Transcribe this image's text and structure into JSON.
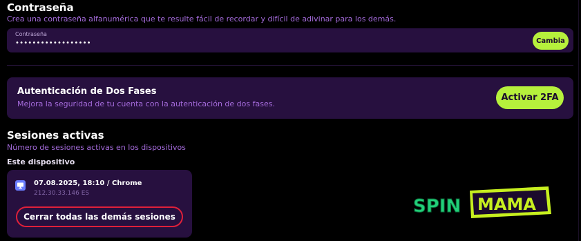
{
  "password_section": {
    "title": "Contraseña",
    "description": "Crea una contraseña alfanumérica que te resulte fácil de recordar y difícil de adivinar para los demás.",
    "field_label": "Contraseña",
    "field_value": "••••••••••••••••••",
    "change_button": "Cambia"
  },
  "two_factor": {
    "title": "Autenticación de Dos Fases",
    "description": "Mejora la seguridad de tu cuenta con la autenticación de dos fases.",
    "button": "Activar 2FA"
  },
  "sessions": {
    "title": "Sesiones activas",
    "description": "Número de sesiones activas en los dispositivos",
    "this_device_label": "Este dispositivo",
    "current": {
      "datetime_browser": "07.08.2025, 18:10 / Chrome",
      "ip_country": "212.30.33.146 ES"
    },
    "close_others_button": "Cerrar todas las demás sesiones"
  },
  "logo": {
    "part1": "SPIN",
    "part2": "MAMA"
  },
  "colors": {
    "background": "#000000",
    "card": "#27103f",
    "accent_green": "#b6f03c",
    "accent_purple": "#a56bdc",
    "danger_red": "#e0203a",
    "device_icon_blue": "#6a7dff"
  },
  "icons": {
    "device": "monitor-icon"
  }
}
